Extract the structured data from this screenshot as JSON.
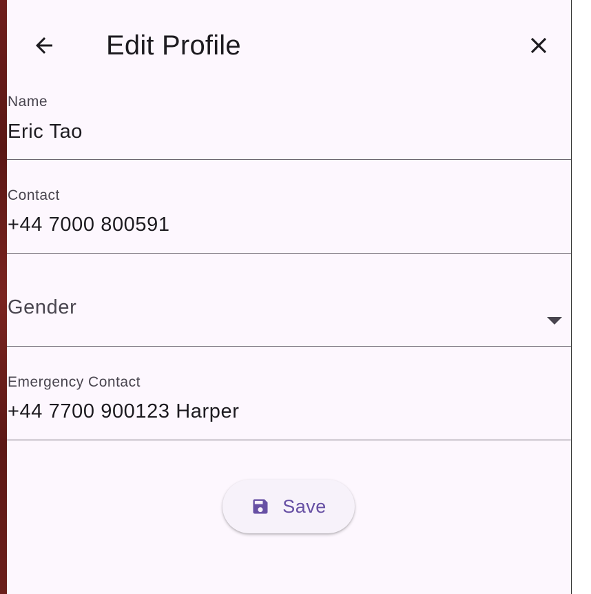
{
  "header": {
    "title": "Edit Profile",
    "back_icon": "arrow-left-icon",
    "close_icon": "close-icon"
  },
  "form": {
    "name": {
      "label": "Name",
      "value": "Eric Tao"
    },
    "contact": {
      "label": "Contact",
      "value": "+44 7000 800591"
    },
    "gender": {
      "label": "Gender",
      "icon": "chevron-down-icon"
    },
    "emergency_contact": {
      "label": "Emergency Contact",
      "value": "+44 7700 900123 Harper"
    }
  },
  "actions": {
    "save_label": "Save",
    "save_icon": "floppy-disk-icon"
  },
  "colors": {
    "background": "#fdf7fe",
    "primary": "#6750a4",
    "text": "#1d1b20",
    "label": "#49454f",
    "divider": "#6b6670",
    "button_surface": "#f7f2fa"
  }
}
